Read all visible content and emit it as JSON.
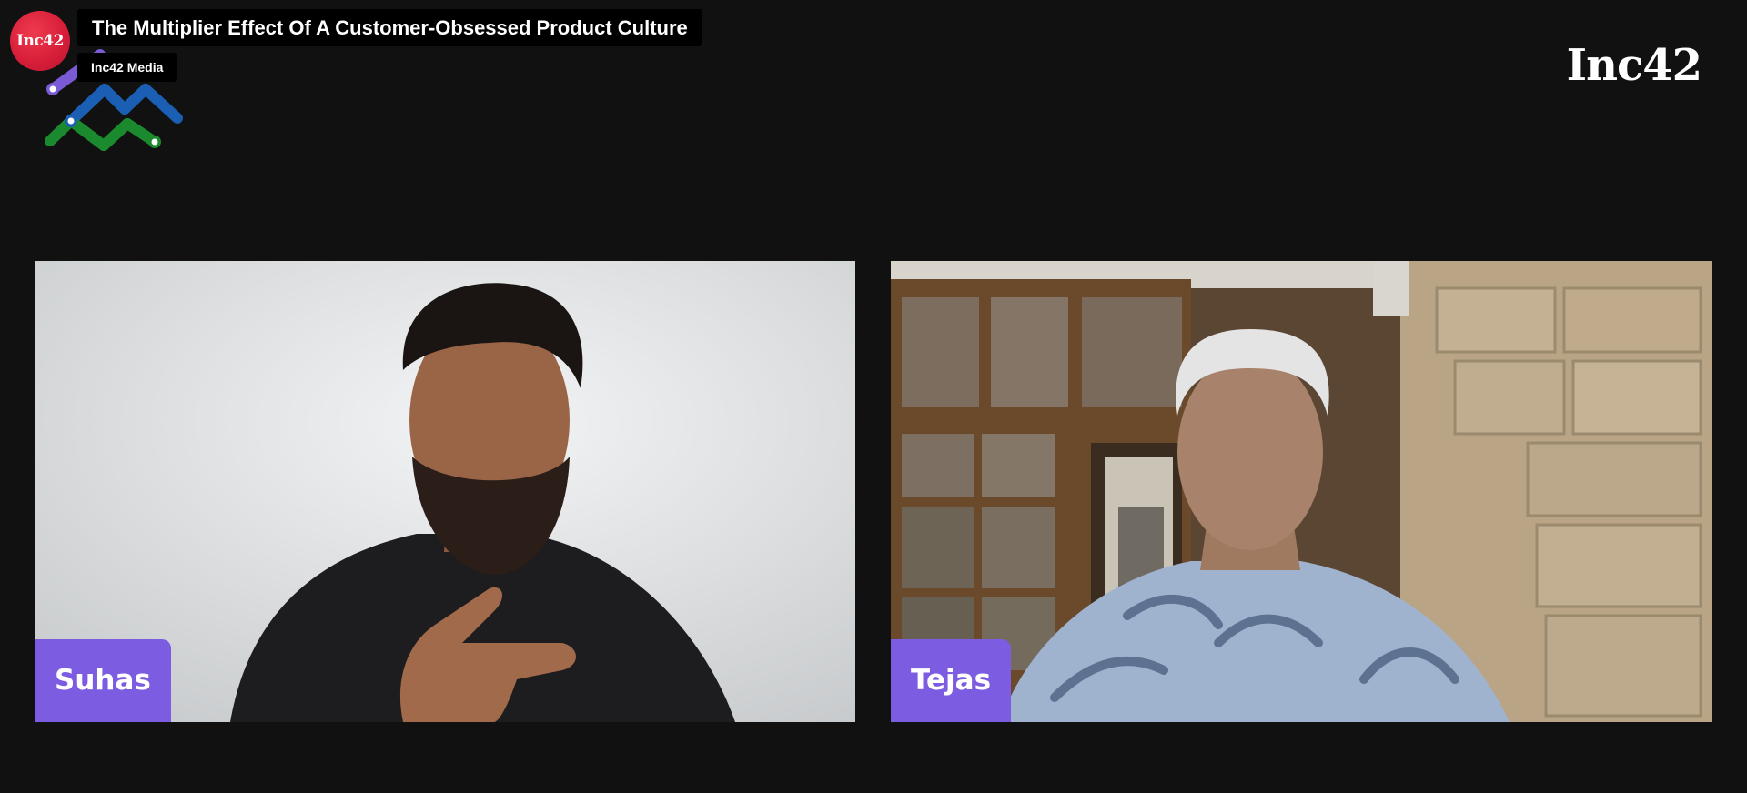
{
  "video": {
    "title": "The Multiplier Effect Of A Customer-Obsessed Product Culture",
    "channel_name": "Inc42 Media",
    "channel_avatar_text": "Inc42"
  },
  "brand": {
    "wordmark": "Inc42"
  },
  "participants": [
    {
      "name": "Suhas"
    },
    {
      "name": "Tejas"
    }
  ],
  "icons": {
    "show_logo": "zigzag-network-logo-icon"
  },
  "colors": {
    "background": "#111111",
    "name_tag": "#7c5ce0",
    "avatar": "#d81f3a"
  }
}
